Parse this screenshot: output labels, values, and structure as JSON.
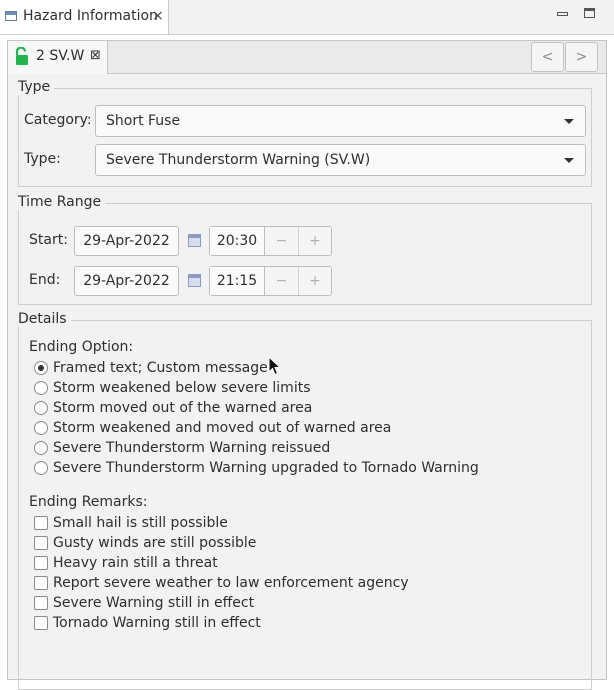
{
  "view": {
    "title": "Hazard Information",
    "close_glyph": "×"
  },
  "editor_tab": {
    "label": "2 SV.W",
    "close_glyph": "⊠",
    "prev": "<",
    "next": ">"
  },
  "type_group": {
    "title": "Type",
    "category_label": "Category:",
    "category_value": "Short Fuse",
    "type_label": "Type:",
    "type_value": "Severe Thunderstorm Warning (SV.W)"
  },
  "time_range": {
    "title": "Time Range",
    "start_label": "Start:",
    "start_date": "29-Apr-2022",
    "start_time": "20:30",
    "end_label": "End:",
    "end_date": "29-Apr-2022",
    "end_time": "21:15",
    "minus": "−",
    "plus": "+"
  },
  "details": {
    "title": "Details",
    "ending_option_label": "Ending Option:",
    "ending_options": [
      {
        "label": "Framed text; Custom message",
        "selected": true
      },
      {
        "label": "Storm weakened below severe limits",
        "selected": false
      },
      {
        "label": "Storm moved out of the warned area",
        "selected": false
      },
      {
        "label": "Storm weakened and moved out of warned area",
        "selected": false
      },
      {
        "label": "Severe Thunderstorm Warning reissued",
        "selected": false
      },
      {
        "label": "Severe Thunderstorm Warning upgraded to Tornado Warning",
        "selected": false
      }
    ],
    "ending_remarks_label": "Ending Remarks:",
    "ending_remarks": [
      {
        "label": "Small hail is still possible",
        "checked": false
      },
      {
        "label": "Gusty winds are still possible",
        "checked": false
      },
      {
        "label": "Heavy rain still a threat",
        "checked": false
      },
      {
        "label": "Report severe weather to law enforcement agency",
        "checked": false
      },
      {
        "label": "Severe Warning still in effect",
        "checked": false
      },
      {
        "label": "Tornado Warning still in effect",
        "checked": false
      }
    ]
  },
  "colors": {
    "lock_icon": "#22b34a",
    "accent_selected_radio": "#333333"
  }
}
